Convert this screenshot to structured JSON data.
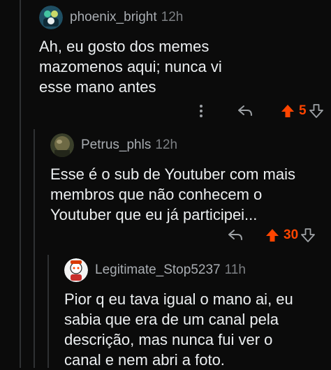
{
  "comments": [
    {
      "author": "phoenix_bright",
      "time": "12h",
      "body": "Ah, eu gosto dos memes mazomenos aqui; nunca vi esse mano antes",
      "votes": "5",
      "upvoted": true
    },
    {
      "author": "Petrus_phls",
      "time": "12h",
      "body": "Esse é o sub de Youtuber com mais membros que não conhecem o Youtuber que eu já participei...",
      "votes": "30",
      "upvoted": true
    },
    {
      "author": "Legitimate_Stop5237",
      "time": "11h",
      "body": "Pior q eu tava igual o mano ai, eu sabia que era de um canal pela descrição, mas nunca fui ver o canal e nem abri a foto."
    }
  ],
  "icons": {
    "more": "more-vertical-icon",
    "reply": "reply-icon",
    "upvote": "upvote-arrow-icon",
    "downvote": "downvote-arrow-icon"
  },
  "colors": {
    "background": "#0b0b0b",
    "upvote": "#ff4500",
    "text": "#eceff1",
    "meta": "#a9adb2"
  }
}
